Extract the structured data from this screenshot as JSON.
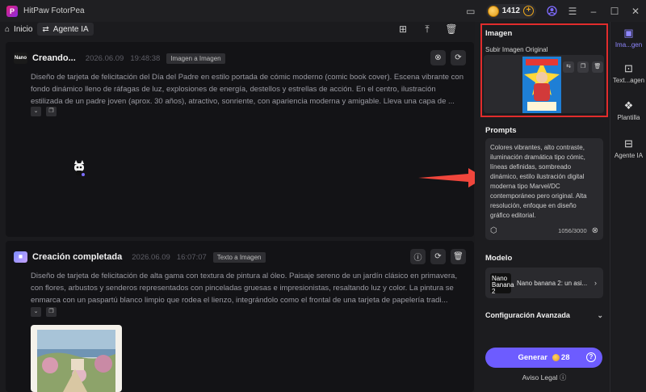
{
  "app": {
    "title": "HitPaw FotorPea",
    "credits": "1412"
  },
  "toolbar": {
    "home_label": "Inicio",
    "agent_label": "Agente IA"
  },
  "cards": [
    {
      "icon_text": "Nano",
      "title": "Creando...",
      "date": "2026.06.09",
      "time": "19:48:38",
      "tag": "Imagen a Imagen",
      "text": "Diseño de tarjeta de felicitación del Día del Padre en estilo portada de cómic moderno (comic book cover). Escena vibrante con fondo dinámico lleno de ráfagas de luz, explosiones de energía, destellos y estrellas de acción. En el centro, ilustración estilizada de un padre joven (aprox. 30 años), atractivo, sonriente, con apariencia moderna y amigable. Lleva una capa de ..."
    },
    {
      "title": "Creación completada",
      "date": "2026.06.09",
      "time": "16:07:07",
      "tag": "Texto a Imagen",
      "text": "Diseño de tarjeta de felicitación de alta gama con textura de pintura al óleo. Paisaje sereno de un jardín clásico en primavera, con flores, arbustos y senderos representados con pinceladas gruesas e impresionistas, resaltando luz y color. La pintura se enmarca con un paspartú blanco limpio que rodea el lienzo, integrándolo como el frontal de una tarjeta de papelería tradi..."
    }
  ],
  "panel": {
    "image_section_title": "Imagen",
    "upload_label": "Subir Imagen Original",
    "prompts_title": "Prompts",
    "prompt_text": "Colores vibrantes, alto contraste, iluminación dramática tipo cómic, líneas definidas, sombreado dinámico, estilo ilustración digital moderna tipo Marvel/DC contemporáneo pero original. Alta resolución, enfoque en diseño gráfico editorial.",
    "char_count": "1056/3000",
    "model_title": "Modelo",
    "model_logo": "Nano Banana 2",
    "model_name": "Nano banana 2: un asi...",
    "advanced_label": "Configuración Avanzada",
    "generate_label": "Generar",
    "generate_cost": "28",
    "legal_label": "Aviso Legal"
  },
  "sidenav": [
    {
      "label": "Ima...gen",
      "icon": "image-icon",
      "active": true
    },
    {
      "label": "Text...agen",
      "icon": "text-image-icon",
      "active": false
    },
    {
      "label": "Plantilla",
      "icon": "template-icon",
      "active": false
    },
    {
      "label": "Agente IA",
      "icon": "agent-icon",
      "active": false
    }
  ],
  "colors": {
    "accent": "#6d5cff",
    "highlight_box": "#e12c2c",
    "arrow": "#f0463c"
  }
}
